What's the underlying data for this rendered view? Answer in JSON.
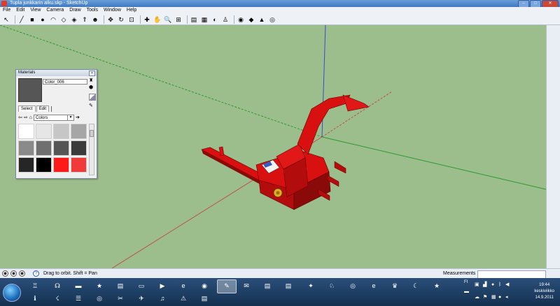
{
  "window": {
    "title": "Tupla junkkarin alku.skp - SketchUp",
    "buttons": {
      "minimize": "–",
      "maximize": "□",
      "close": "✕"
    }
  },
  "menu": [
    "File",
    "Edit",
    "View",
    "Camera",
    "Draw",
    "Tools",
    "Window",
    "Help"
  ],
  "toolbar": {
    "icons": [
      "select-icon",
      "pencil-icon",
      "rectangle-icon",
      "circle-icon",
      "arc-icon",
      "eraser-icon",
      "paint-bucket-icon",
      "push-pull-icon",
      "follow-me-icon",
      "move-icon",
      "rotate-icon",
      "offset-icon",
      "orbit-icon",
      "pan-icon",
      "zoom-icon",
      "zoom-extents-icon",
      "section-icon",
      "components-icon",
      "styles-icon",
      "walk-icon",
      "look-around-icon",
      "layers-icon",
      "sandbox-icon",
      "warehouse-icon"
    ],
    "glyphs": [
      "↖",
      "╱",
      "■",
      "●",
      "◠",
      "◇",
      "◈",
      "⇑",
      "☻",
      "✥",
      "↻",
      "⊡",
      "✚",
      "✋",
      "🔍",
      "⊞",
      "▤",
      "▦",
      "◐",
      "♙",
      "◉",
      "◆",
      "▲",
      "◎"
    ]
  },
  "materials_panel": {
    "title": "Materials",
    "close": "×",
    "current_material": "Color_006",
    "tabs": [
      "Select",
      "Edit"
    ],
    "collection": "Colors",
    "swatch_colors": [
      "#ffffff",
      "#e6e6e6",
      "#c6c6c6",
      "#a6a6a6",
      "#8a8a8a",
      "#6f6f6f",
      "#555555",
      "#3b3b3b",
      "#262626",
      "#000000",
      "#ff1a1a",
      "#f03a3a"
    ],
    "preview_color": "#565656"
  },
  "statusbar": {
    "hint": "Drag to orbit.  Shift = Pan",
    "measurements_label": "Measurements",
    "measurements_value": ""
  },
  "taskbar": {
    "clock_time": "19:44",
    "clock_day": "keskiviikko",
    "clock_date": "14.9.2011",
    "language": "FI"
  },
  "colors": {
    "viewport_bg": "#9cbe8c",
    "model_red": "#d81010",
    "model_dark_red": "#8a0a0a",
    "axis_red": "#c0504a",
    "axis_green": "#2c9a2c",
    "axis_blue": "#3a4ad0"
  }
}
